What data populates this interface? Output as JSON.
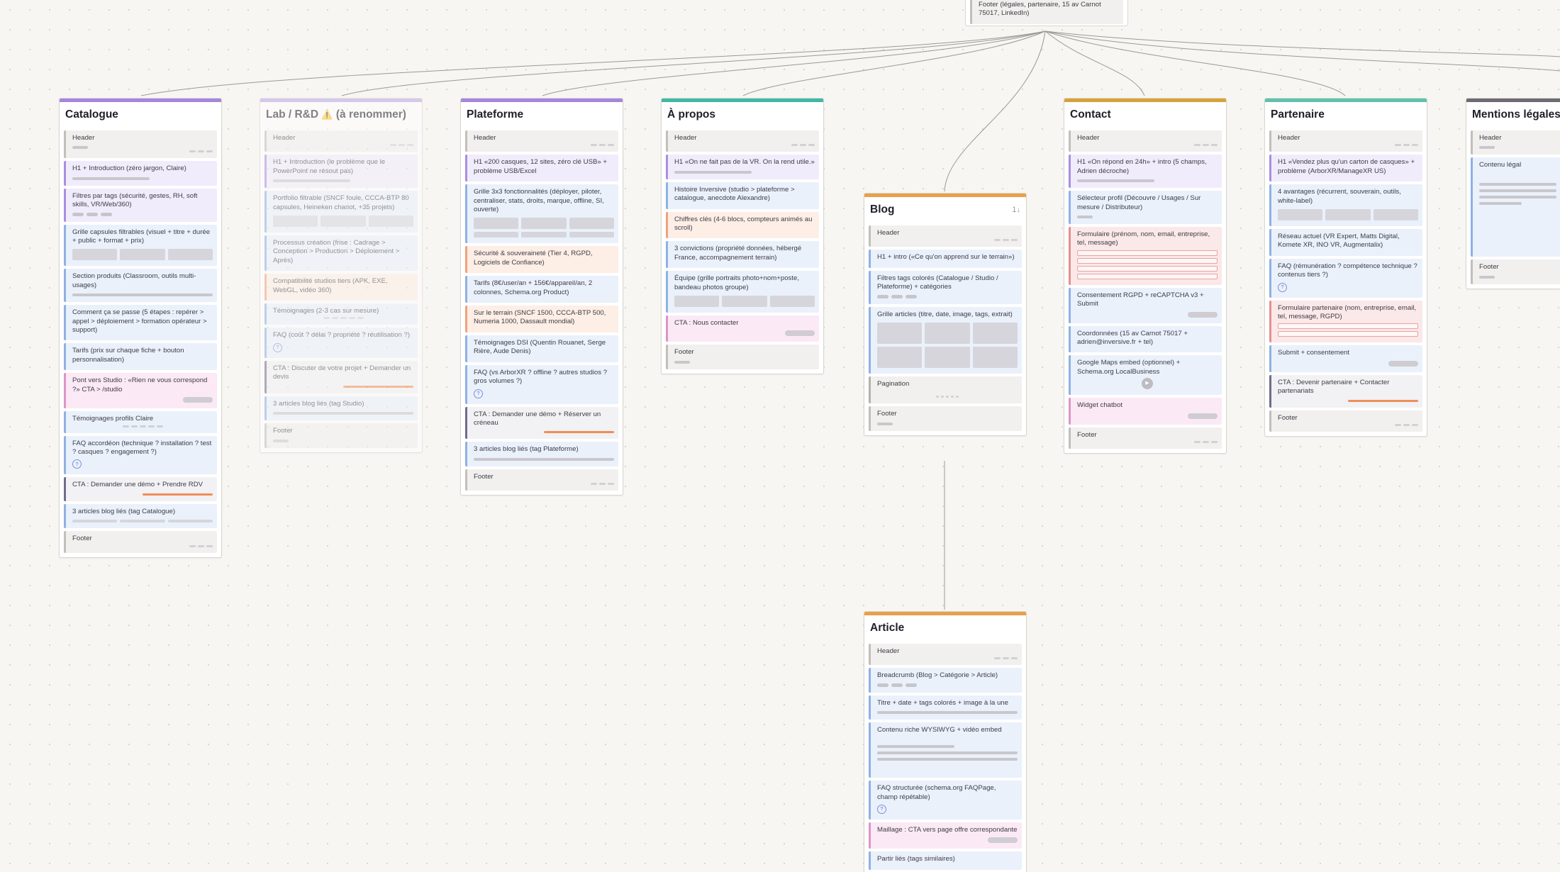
{
  "colors": {
    "catalogue": "#a586dd",
    "lab": "#b8a6e6",
    "plateforme": "#a586dd",
    "apropos": "#3fb8a4",
    "blog": "#e6a14a",
    "contact": "#d6a33b",
    "partenaire": "#5ec2ad",
    "mentions": "#6d6a74",
    "article": "#e6a14a",
    "connector": "#9a9994"
  },
  "top_card": {
    "text": "Footer (légales, partenaire, 15 av Carnot 75017, LinkedIn)"
  },
  "cards": {
    "catalogue": {
      "title": "Catalogue",
      "sections": {
        "s1": "Header",
        "s2": "H1 + Introduction (zéro jargon, Claire)",
        "s3": "Filtres par tags (sécurité, gestes, RH, soft skills, VR/Web/360)",
        "s4": "Grille capsules filtrables (visuel + titre + durée + public + format + prix)",
        "s5": "Section produits (Classroom, outils multi-usages)",
        "s6": "Comment ça se passe (5 étapes : repérer > appel > déploiement > formation opérateur > support)",
        "s7": "Tarifs (prix sur chaque fiche + bouton personnalisation)",
        "s8": "Pont vers Studio : «Rien ne vous correspond ?» CTA > /studio",
        "s9": "Témoignages profils Claire",
        "s10": "FAQ accordéon (technique ? installation ? test ? casques ? engagement ?)",
        "s11": "CTA : Demander une démo + Prendre RDV",
        "s12": "3 articles blog liés (tag Catalogue)",
        "s13": "Footer"
      }
    },
    "lab": {
      "title": "Lab / R&D",
      "title_suffix": "(à renommer)",
      "warning_icon": "⚠️",
      "sections": {
        "s1": "Header",
        "s2": "H1 + Introduction (le problème que le PowerPoint ne résout pas)",
        "s3": "Portfolio filtrable (SNCF foule, CCCA-BTP 80 capsules, Heineken chariot, +35 projets)",
        "s4": "Processus création (frise : Cadrage > Conception > Production > Déploiement > Après)",
        "s5": "Compatibilité studios tiers (APK, EXE, WebGL, vidéo 360)",
        "s6": "Témoignages (2-3 cas sur mesure)",
        "s7": "FAQ (coût ? délai ? propriété ? réutilisation ?)",
        "s8": "CTA : Discuter de votre projet + Demander un devis",
        "s9": "3 articles blog liés (tag Studio)",
        "s10": "Footer"
      }
    },
    "plateforme": {
      "title": "Plateforme",
      "sections": {
        "s1": "Header",
        "s2": "H1 «200 casques, 12 sites, zéro clé USB» + problème USB/Excel",
        "s3": "Grille 3x3 fonctionnalités (déployer, piloter, centraliser, stats, droits, marque, offline, SI, ouverte)",
        "s4": "Sécurité & souveraineté (Tier 4, RGPD, Logiciels de Confiance)",
        "s5": "Tarifs (8€/user/an + 156€/appareil/an, 2 colonnes, Schema.org Product)",
        "s6": "Sur le terrain (SNCF 1500, CCCA-BTP 500, Numeria 1000, Dassault mondial)",
        "s7": "Témoignages DSI (Quentin Rouanet, Serge Rière, Aude Denis)",
        "s8": "FAQ (vs ArborXR ? offline ? autres studios ? gros volumes ?)",
        "s9": "CTA : Demander une démo + Réserver un créneau",
        "s10": "3 articles blog liés (tag Plateforme)",
        "s11": "Footer"
      }
    },
    "apropos": {
      "title": "À propos",
      "sections": {
        "s1": "Header",
        "s2": "H1 «On ne fait pas de la VR. On la rend utile.»",
        "s3": "Histoire Inversive (studio > plateforme > catalogue, anecdote Alexandre)",
        "s4": "Chiffres clés (4-6 blocs, compteurs animés au scroll)",
        "s5": "3 convictions (propriété données, hébergé France, accompagnement terrain)",
        "s6": "Équipe (grille portraits photo+nom+poste, bandeau photos groupe)",
        "s7": "CTA : Nous contacter",
        "s8": "Footer"
      }
    },
    "blog": {
      "title": "Blog",
      "sort": "1↓",
      "sections": {
        "s1": "Header",
        "s2": "H1 + intro («Ce qu'on apprend sur le terrain»)",
        "s3": "Filtres tags colorés (Catalogue / Studio / Plateforme) + catégories",
        "s4": "Grille articles (titre, date, image, tags, extrait)",
        "s5": "Pagination",
        "s6": "Footer"
      }
    },
    "contact": {
      "title": "Contact",
      "sections": {
        "s1": "Header",
        "s2": "H1 «On répond en 24h» + intro (5 champs, Adrien décroche)",
        "s3": "Sélecteur profil (Découvre / Usages / Sur mesure / Distributeur)",
        "s4": "Formulaire (prénom, nom, email, entreprise, tel, message)",
        "s5": "Consentement RGPD + reCAPTCHA v3 + Submit",
        "s6": "Coordonnées (15 av Carnot 75017 + adrien@inversive.fr + tel)",
        "s7": "Google Maps embed (optionnel) + Schema.org LocalBusiness",
        "s8": "Widget chatbot",
        "s9": "Footer"
      }
    },
    "partenaire": {
      "title": "Partenaire",
      "sections": {
        "s1": "Header",
        "s2": "H1 «Vendez plus qu'un carton de casques» + problème (ArborXR/ManageXR US)",
        "s3": "4 avantages (récurrent, souverain, outils, white-label)",
        "s4": "Réseau actuel (VR Expert, Matts Digital, Komete XR, INO VR, Augmentalix)",
        "s5": "FAQ (rémunération ? compétence technique ? contenus tiers ?)",
        "s6": "Formulaire partenaire (nom, entreprise, email, tel, message, RGPD)",
        "s7": "Submit + consentement",
        "s8": "CTA : Devenir partenaire + Contacter partenariats",
        "s9": "Footer"
      }
    },
    "mentions": {
      "title": "Mentions légales",
      "sections": {
        "s1": "Header",
        "s2": "Contenu légal",
        "s3": "Footer"
      }
    },
    "article": {
      "title": "Article",
      "sections": {
        "s1": "Header",
        "s2": "Breadcrumb (Blog > Catégorie > Article)",
        "s3": "Titre + date + tags colorés + image à la une",
        "s4": "Contenu riche WYSIWYG + vidéo embed",
        "s5": "FAQ structurée (schema.org FAQPage, champ répétable)",
        "s6": "Maillage : CTA vers page offre correspondante",
        "s7": "Partir liés (tags similaires)"
      }
    }
  }
}
